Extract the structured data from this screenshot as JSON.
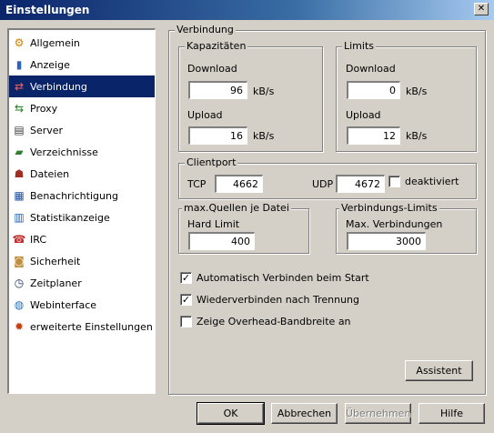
{
  "window": {
    "title": "Einstellungen",
    "close_glyph": "✕"
  },
  "sidebar": {
    "items": [
      {
        "label": "Allgemein",
        "icon": "gear-icon",
        "glyph": "⚙",
        "color": "#d08000"
      },
      {
        "label": "Anzeige",
        "icon": "display-icon",
        "glyph": "▮",
        "color": "#3060c0"
      },
      {
        "label": "Verbindung",
        "icon": "connection-icon",
        "glyph": "⇄",
        "color": "#c02020",
        "selected": true
      },
      {
        "label": "Proxy",
        "icon": "proxy-icon",
        "glyph": "⇆",
        "color": "#208020"
      },
      {
        "label": "Server",
        "icon": "server-icon",
        "glyph": "▤",
        "color": "#404040"
      },
      {
        "label": "Verzeichnisse",
        "icon": "folder-icon",
        "glyph": "▰",
        "color": "#308030"
      },
      {
        "label": "Dateien",
        "icon": "files-icon",
        "glyph": "☗",
        "color": "#a03020"
      },
      {
        "label": "Benachrichtigung",
        "icon": "notification-icon",
        "glyph": "▦",
        "color": "#2050a0"
      },
      {
        "label": "Statistikanzeige",
        "icon": "statistics-icon",
        "glyph": "▥",
        "color": "#2060b0"
      },
      {
        "label": "IRC",
        "icon": "irc-icon",
        "glyph": "☎",
        "color": "#c03030"
      },
      {
        "label": "Sicherheit",
        "icon": "lock-icon",
        "glyph": "◙",
        "color": "#c09040"
      },
      {
        "label": "Zeitplaner",
        "icon": "clock-icon",
        "glyph": "◷",
        "color": "#203060"
      },
      {
        "label": "Webinterface",
        "icon": "globe-icon",
        "glyph": "◍",
        "color": "#2070c0"
      },
      {
        "label": "erweiterte Einstellungen",
        "icon": "advanced-settings-icon",
        "glyph": "✹",
        "color": "#c04010"
      }
    ]
  },
  "connection": {
    "title": "Verbindung",
    "capacities": {
      "title": "Kapazitäten",
      "download_label": "Download",
      "download_value": "96",
      "download_unit": "kB/s",
      "upload_label": "Upload",
      "upload_value": "16",
      "upload_unit": "kB/s"
    },
    "limits": {
      "title": "Limits",
      "download_label": "Download",
      "download_value": "0",
      "download_unit": "kB/s",
      "upload_label": "Upload",
      "upload_value": "12",
      "upload_unit": "kB/s"
    },
    "clientport": {
      "title": "Clientport",
      "tcp_label": "TCP",
      "tcp_value": "4662",
      "udp_label": "UDP",
      "udp_value": "4672",
      "disabled_label": "deaktiviert"
    },
    "max_sources": {
      "title": "max.Quellen je Datei",
      "hard_limit_label": "Hard Limit",
      "hard_limit_value": "400"
    },
    "connection_limits": {
      "title": "Verbindungs-Limits",
      "max_connections_label": "Max. Verbindungen",
      "max_connections_value": "3000"
    },
    "options": [
      {
        "label": "Automatisch Verbinden beim Start",
        "checked": true
      },
      {
        "label": "Wiederverbinden nach Trennung",
        "checked": true
      },
      {
        "label": "Zeige Overhead-Bandbreite an",
        "checked": false
      }
    ],
    "wizard_button": "Assistent"
  },
  "footer": {
    "ok": "OK",
    "cancel": "Abbrechen",
    "apply": "Übernehmen",
    "help": "Hilfe"
  },
  "check_glyph": "✓"
}
